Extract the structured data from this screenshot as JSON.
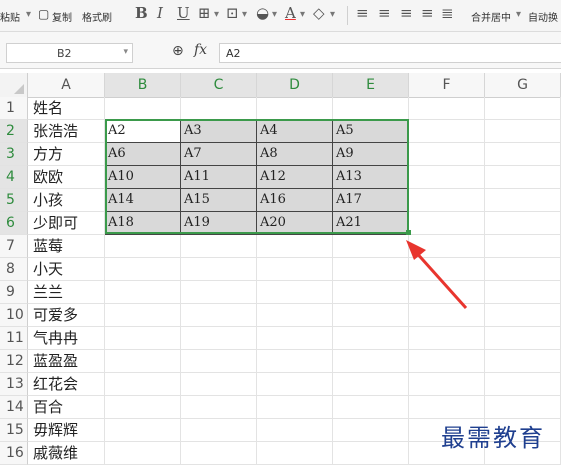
{
  "toolbar": {
    "paste_label": "粘贴",
    "copy_label": "复制",
    "format_painter_label": "格式刷",
    "bold_glyph": "B",
    "italic_glyph": "I",
    "underline_glyph": "U",
    "merge_center_label": "合并居中",
    "auto_wrap_label": "自动换"
  },
  "formula_bar": {
    "name_box": "B2",
    "fx_label": "fx",
    "formula_value": "A2"
  },
  "columns": [
    "A",
    "B",
    "C",
    "D",
    "E",
    "F",
    "G"
  ],
  "selected_columns": [
    "B",
    "C",
    "D",
    "E"
  ],
  "rows": [
    "1",
    "2",
    "3",
    "4",
    "5",
    "6",
    "7",
    "8",
    "9",
    "10",
    "11",
    "12",
    "13",
    "14",
    "15",
    "16"
  ],
  "column_a": [
    "姓名",
    "张浩浩",
    "方方",
    "欧欧",
    "小孩",
    "少即可",
    "蓝莓",
    "小天",
    "兰兰",
    "可爱多",
    "气冉冉",
    "蓝盈盈",
    "红花会",
    "百合",
    "毋辉辉",
    "戚薇维"
  ],
  "grid_values": [
    [
      "A2",
      "A3",
      "A4",
      "A5"
    ],
    [
      "A6",
      "A7",
      "A8",
      "A9"
    ],
    [
      "A10",
      "A11",
      "A12",
      "A13"
    ],
    [
      "A14",
      "A15",
      "A16",
      "A17"
    ],
    [
      "A18",
      "A19",
      "A20",
      "A21"
    ]
  ],
  "colors": {
    "selection_border": "#3b9a4b",
    "selected_fill": "#d9d9d9",
    "arrow": "#e8352e",
    "watermark": "#1f3f8f"
  },
  "watermark": "最需教育"
}
